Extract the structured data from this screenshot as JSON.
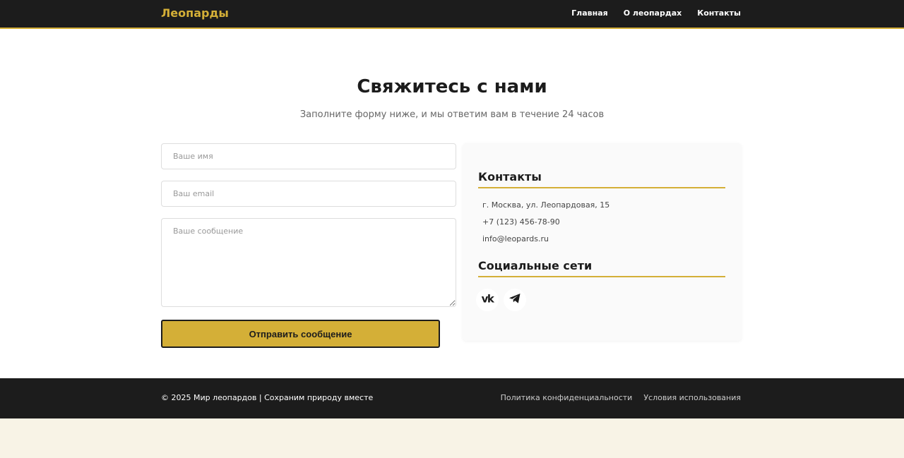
{
  "header": {
    "brand": "Леопарды",
    "nav": [
      "Главная",
      "О леопардах",
      "Контакты"
    ]
  },
  "hero": {
    "title": "Свяжитесь с нами",
    "subtitle": "Заполните форму ниже, и мы ответим вам в течение 24 часов"
  },
  "form": {
    "name_placeholder": "Ваше имя",
    "email_placeholder": "Ваш email",
    "message_placeholder": "Ваше сообщение",
    "submit_label": "Отправить сообщение"
  },
  "info": {
    "contacts_heading": "Контакты",
    "address": "г. Москва, ул. Леопардовая, 15",
    "phone": "+7 (123) 456-78-90",
    "email": "info@leopards.ru",
    "social_heading": "Социальные сети",
    "social_icons": [
      "vk-icon",
      "telegram-icon"
    ]
  },
  "footer": {
    "copyright": "© 2025 Мир леопардов | Сохраним природу вместе",
    "links": [
      "Политика конфиденциальности",
      "Условия использования"
    ]
  },
  "colors": {
    "accent": "#d4af37",
    "dark": "#1c1c1c",
    "page_background": "#f8f3e6"
  }
}
